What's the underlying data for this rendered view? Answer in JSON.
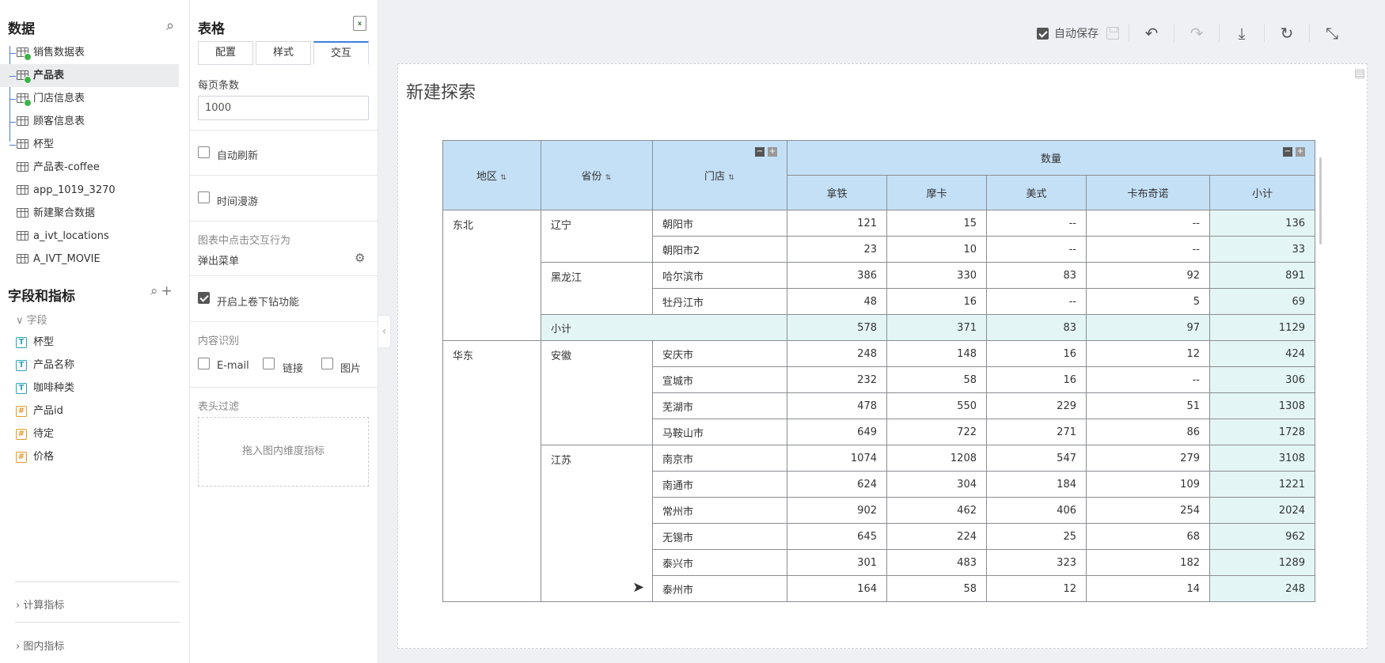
{
  "data_panel": {
    "title": "数据",
    "datasets": [
      {
        "name": "销售数据表",
        "ready": true,
        "selected": false
      },
      {
        "name": "产品表",
        "ready": true,
        "selected": true
      },
      {
        "name": "门店信息表",
        "ready": true,
        "selected": false
      },
      {
        "name": "顾客信息表",
        "ready": false,
        "selected": false
      },
      {
        "name": "杯型",
        "ready": false,
        "selected": false
      },
      {
        "name": "产品表-coffee",
        "ready": false,
        "selected": false
      },
      {
        "name": "app_1019_3270",
        "ready": false,
        "selected": false
      },
      {
        "name": "新建聚合数据",
        "ready": false,
        "selected": false
      },
      {
        "name": "a_ivt_locations",
        "ready": false,
        "selected": false
      },
      {
        "name": "A_IVT_MOVIE",
        "ready": false,
        "selected": false
      }
    ]
  },
  "fields_panel": {
    "title": "字段和指标",
    "group_label": "字段",
    "fields": [
      {
        "name": "杯型",
        "type": "T"
      },
      {
        "name": "产品名称",
        "type": "T"
      },
      {
        "name": "咖啡种类",
        "type": "T"
      },
      {
        "name": "产品id",
        "type": "#"
      },
      {
        "name": "待定",
        "type": "#"
      },
      {
        "name": "价格",
        "type": "#"
      }
    ],
    "calc_metrics": "计算指标",
    "chart_metrics": "图内指标"
  },
  "config_panel": {
    "title": "表格",
    "excel_icon_text": "x",
    "tabs": [
      "配置",
      "样式",
      "交互"
    ],
    "active_tab": "交互",
    "page_size_label": "每页条数",
    "page_size_value": "1000",
    "auto_refresh": {
      "label": "自动刷新",
      "checked": false
    },
    "time_roam": {
      "label": "时间漫游",
      "checked": false
    },
    "click_behavior_label": "图表中点击交互行为",
    "click_behavior_value": "弹出菜单",
    "drill": {
      "label": "开启上卷下钻功能",
      "checked": true
    },
    "content_recog_label": "内容识别",
    "recog_options": [
      {
        "label": "E-mail",
        "checked": false
      },
      {
        "label": "链接",
        "checked": false
      },
      {
        "label": "图片",
        "checked": false
      }
    ],
    "header_filter_label": "表头过滤",
    "dropzone_text": "拖入图内维度指标"
  },
  "toolbar": {
    "autosave_label": "自动保存",
    "autosave_checked": true,
    "icons": [
      "save-icon",
      "undo-icon",
      "redo-icon",
      "download-icon",
      "refresh-icon",
      "collapse-icon"
    ]
  },
  "canvas": {
    "title": "新建探索"
  },
  "table": {
    "headers": {
      "region": "地区",
      "province": "省份",
      "store": "门店",
      "quantity": "数量",
      "measures": [
        "拿铁",
        "摩卡",
        "美式",
        "卡布奇诺",
        "小计"
      ]
    },
    "subtotal_label": "小计",
    "rows": [
      {
        "region": "东北",
        "province": "辽宁",
        "store": "朝阳市",
        "values": [
          "121",
          "15",
          "--",
          "--",
          "136"
        ]
      },
      {
        "region": "",
        "province": "",
        "store": "朝阳市2",
        "values": [
          "23",
          "10",
          "--",
          "--",
          "33"
        ]
      },
      {
        "region": "",
        "province": "黑龙江",
        "store": "哈尔滨市",
        "values": [
          "386",
          "330",
          "83",
          "92",
          "891"
        ]
      },
      {
        "region": "",
        "province": "",
        "store": "牡丹江市",
        "values": [
          "48",
          "16",
          "--",
          "5",
          "69"
        ]
      },
      {
        "subtotal": true,
        "values": [
          "578",
          "371",
          "83",
          "97",
          "1129"
        ]
      },
      {
        "region": "华东",
        "province": "安徽",
        "store": "安庆市",
        "values": [
          "248",
          "148",
          "16",
          "12",
          "424"
        ]
      },
      {
        "region": "",
        "province": "",
        "store": "宣城市",
        "values": [
          "232",
          "58",
          "16",
          "--",
          "306"
        ]
      },
      {
        "region": "",
        "province": "",
        "store": "芜湖市",
        "values": [
          "478",
          "550",
          "229",
          "51",
          "1308"
        ]
      },
      {
        "region": "",
        "province": "",
        "store": "马鞍山市",
        "values": [
          "649",
          "722",
          "271",
          "86",
          "1728"
        ]
      },
      {
        "region": "",
        "province": "江苏",
        "store": "南京市",
        "values": [
          "1074",
          "1208",
          "547",
          "279",
          "3108"
        ]
      },
      {
        "region": "",
        "province": "",
        "store": "南通市",
        "values": [
          "624",
          "304",
          "184",
          "109",
          "1221"
        ]
      },
      {
        "region": "",
        "province": "",
        "store": "常州市",
        "values": [
          "902",
          "462",
          "406",
          "254",
          "2024"
        ]
      },
      {
        "region": "",
        "province": "",
        "store": "无锡市",
        "values": [
          "645",
          "224",
          "25",
          "68",
          "962"
        ]
      },
      {
        "region": "",
        "province": "",
        "store": "泰兴市",
        "values": [
          "301",
          "483",
          "323",
          "182",
          "1289"
        ]
      },
      {
        "region": "",
        "province": "",
        "store": "泰州市",
        "values": [
          "164",
          "58",
          "12",
          "14",
          "248"
        ]
      }
    ]
  }
}
